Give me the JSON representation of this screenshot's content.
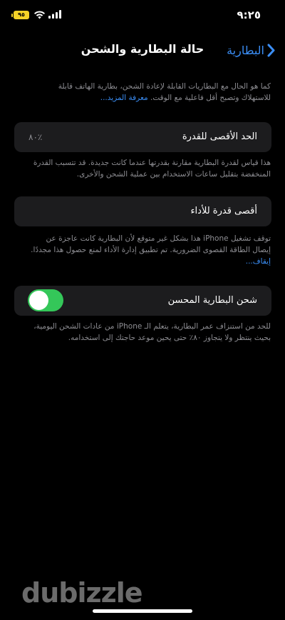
{
  "status": {
    "time": "٩:٢٥",
    "battery_level": "٩٥",
    "battery_color": "#f5d327",
    "icons": [
      "wifi-icon",
      "signal-icon",
      "battery-icon"
    ]
  },
  "nav": {
    "back_label": "البطارية",
    "title": "حالة البطارية والشحن",
    "accent": "#3b8ef5"
  },
  "intro": {
    "text": "كما هو الحال مع البطاريات القابلة لإعادة الشحن، بطارية الهاتف قابلة للاستهلاك وتصبح أقل فاعلية مع الوقت.",
    "link": "معرفة المزيد..."
  },
  "max_capacity": {
    "label": "الحد الأقصى للقدرة",
    "value": "٪٨٠",
    "note": "هذا قياس لقدرة البطارية مقارنة بقدرتها عندما كانت جديدة. قد تتسبب القدرة المنخفضة بتقليل ساعات الاستخدام بين عملية الشحن والأخرى."
  },
  "peak_performance": {
    "label": "أقصى قدرة للأداء",
    "note": "توقف تشغيل iPhone هذا بشكل غير متوقع لأن البطارية كانت عاجزة عن إيصال الطاقة القصوى الضرورية. تم تطبيق إدارة الأداء لمنع حصول هذا مجددًا.",
    "link": "إيقاف..."
  },
  "optimized_charging": {
    "label": "شحن البطارية المحسن",
    "enabled": true,
    "toggle_color": "#34c759",
    "note": "للحد من استنزاف عمر البطارية، يتعلم الـ iPhone من عادات الشحن اليومية، بحيث ينتظر ولا يتجاوز ٨٠٪ حتى يحين موعد حاجتك إلى استخدامه."
  },
  "watermark": "dubizzle"
}
